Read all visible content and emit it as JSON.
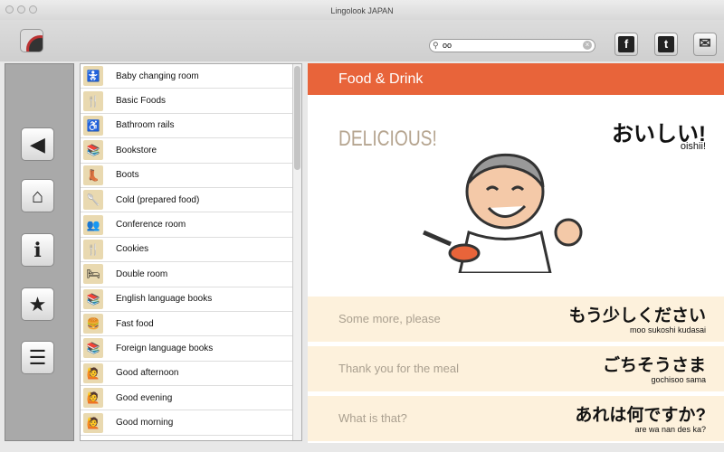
{
  "window": {
    "title": "Lingolook JAPAN"
  },
  "search": {
    "value": "oo"
  },
  "share": {
    "facebook": "f",
    "twitter": "t",
    "mail": "✉"
  },
  "nav": [
    {
      "name": "back",
      "glyph": "◀"
    },
    {
      "name": "home",
      "glyph": "⌂"
    },
    {
      "name": "info",
      "glyph": "ℹ"
    },
    {
      "name": "favorites",
      "glyph": "★"
    },
    {
      "name": "list",
      "glyph": "☰"
    }
  ],
  "list": [
    {
      "label": "Baby changing room",
      "icon": "🚼"
    },
    {
      "label": "Basic Foods",
      "icon": "🍴"
    },
    {
      "label": "Bathroom rails",
      "icon": "♿"
    },
    {
      "label": "Bookstore",
      "icon": "📚"
    },
    {
      "label": "Boots",
      "icon": "👢"
    },
    {
      "label": "Cold (prepared food)",
      "icon": "🥄"
    },
    {
      "label": "Conference room",
      "icon": "👥"
    },
    {
      "label": "Cookies",
      "icon": "🍴"
    },
    {
      "label": "Double room",
      "icon": "🛏"
    },
    {
      "label": "English language books",
      "icon": "📚"
    },
    {
      "label": "Fast food",
      "icon": "🍔"
    },
    {
      "label": "Foreign language books",
      "icon": "📚"
    },
    {
      "label": "Good afternoon",
      "icon": "🙋"
    },
    {
      "label": "Good evening",
      "icon": "🙋"
    },
    {
      "label": "Good morning",
      "icon": "🙋"
    }
  ],
  "detail": {
    "category": "Food & Drink",
    "main": {
      "en": "DELICIOUS!",
      "jp": "おいしい!",
      "romaji": "oishii!"
    },
    "phrases": [
      {
        "en": "Some more, please",
        "jp": "もう少しください",
        "romaji": "moo sukoshi kudasai"
      },
      {
        "en": "Thank you for the meal",
        "jp": "ごちそうさま",
        "romaji": "gochisoo sama"
      },
      {
        "en": "What is that?",
        "jp": "あれは何ですか?",
        "romaji": "are wa nan des ka?"
      }
    ]
  },
  "colors": {
    "accent": "#e8643a",
    "phrase_bg": "#fdf1dc"
  }
}
